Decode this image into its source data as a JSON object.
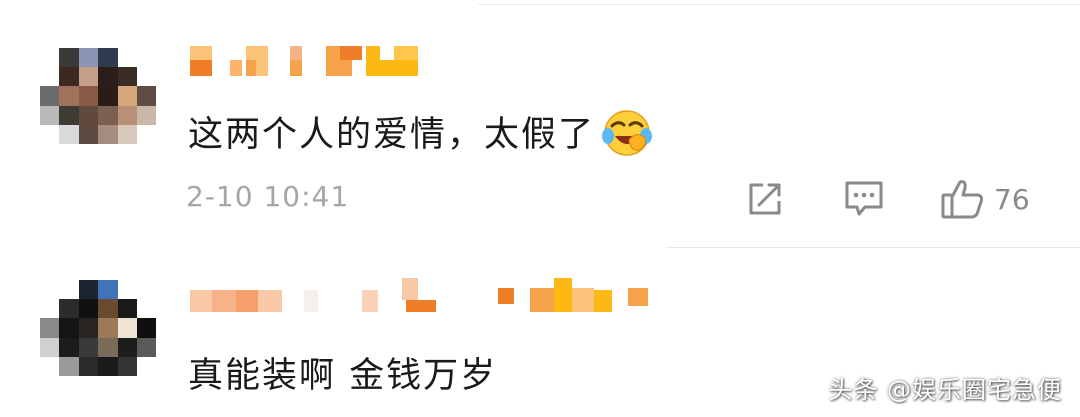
{
  "comments": [
    {
      "text": "这两个人的爱情，太假了",
      "emoji": "laughing-crying-emoji",
      "time": "2-10 10:41",
      "like_count": "76"
    },
    {
      "text": "真能装啊 金钱万岁"
    }
  ],
  "icons": {
    "share": "share-icon",
    "reply": "comment-icon",
    "like": "thumbs-up-icon"
  },
  "colors": {
    "text": "#1a1a1a",
    "meta": "#a6a6a6",
    "username_pixels": [
      "#f07d27",
      "#f5a24a",
      "#fbc27a",
      "#fcb813"
    ]
  },
  "watermark": "头条 @娱乐圈宅急便"
}
